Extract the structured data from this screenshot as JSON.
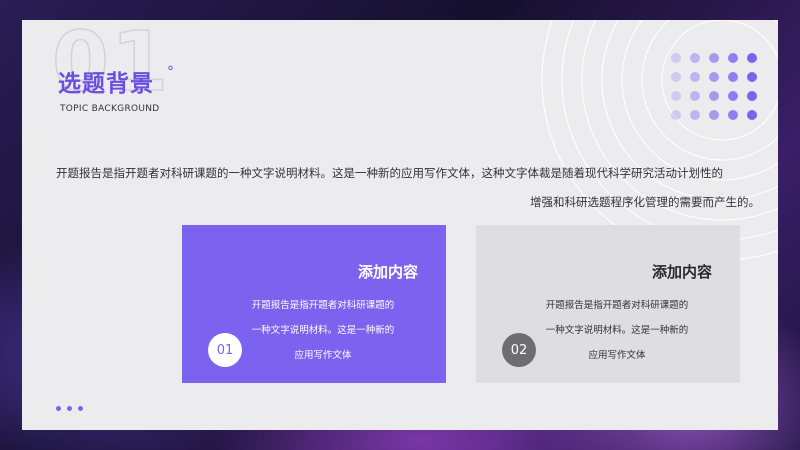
{
  "slide": {
    "number_watermark": "01",
    "title": "选题背景",
    "title_mark": "°",
    "subtitle": "TOPIC BACKGROUND",
    "description": {
      "line1": "开题报告是指开题者对科研课题的一种文字说明材料。这是一种新的应用写作文体，这种文字体裁是随着现代科学研究活动计划性的",
      "line2": "增强和科研选题程序化管理的需要而产生的。"
    },
    "boxes": [
      {
        "title": "添加内容",
        "lines": [
          "开题报告是指开题者对科研课题的",
          "一种文字说明材料。这是一种新的",
          "应用写作文体"
        ],
        "badge": "01"
      },
      {
        "title": "添加内容",
        "lines": [
          "开题报告是指开题者对科研课题的",
          "一种文字说明材料。这是一种新的",
          "应用写作文体"
        ],
        "badge": "02"
      }
    ]
  },
  "colors": {
    "accent": "#7b62ef",
    "title": "#6b4fe0",
    "card": "#ececef",
    "box2": "#dedee2",
    "badge2": "#6d6d72"
  }
}
